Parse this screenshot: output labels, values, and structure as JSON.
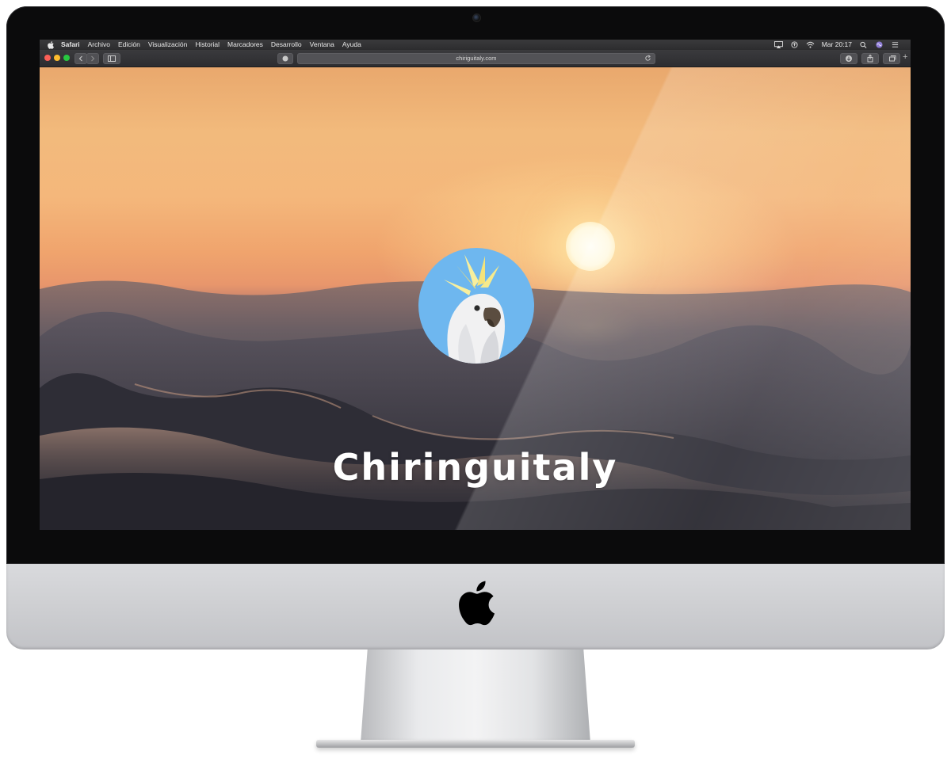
{
  "menubar": {
    "app": "Safari",
    "items": [
      "Archivo",
      "Edición",
      "Visualización",
      "Historial",
      "Marcadores",
      "Desarrollo",
      "Ventana",
      "Ayuda"
    ],
    "clock": "Mar 20:17"
  },
  "toolbar": {
    "url": "chiriguitaly.com"
  },
  "page": {
    "title": "Chiringuitaly"
  },
  "colors": {
    "logo_background": "#6eb7ef",
    "sunset_sky": "#f2ba7c",
    "sea": "#2f2f39"
  },
  "icons": [
    "apple-icon",
    "back-icon",
    "forward-icon",
    "sidebar-icon",
    "reader-icon",
    "reload-icon",
    "download-icon",
    "share-icon",
    "tabs-icon",
    "airplay-icon",
    "wifi-icon",
    "search-icon",
    "siri-icon"
  ]
}
